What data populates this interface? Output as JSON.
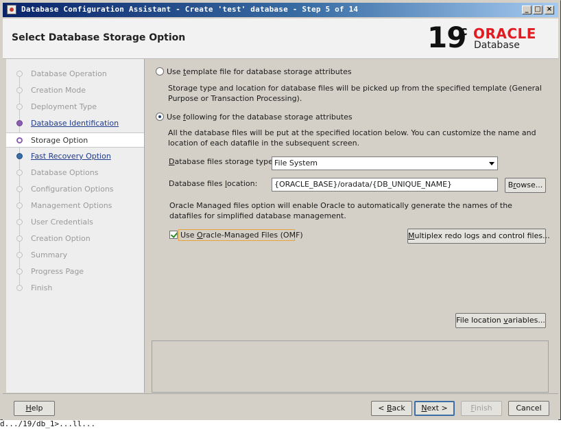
{
  "window": {
    "title": "Database Configuration Assistant - Create 'test' database - Step 5 of 14",
    "controls": {
      "minimize": "_",
      "maximize": "□",
      "close": "×"
    }
  },
  "header": {
    "page_title": "Select Database Storage Option",
    "version_number": "19",
    "version_suffix": "c",
    "brand": "ORACLE",
    "product": "Database",
    "brand_color": "#e11b22"
  },
  "nav": {
    "items": [
      {
        "label": "Database Operation",
        "state": "pending"
      },
      {
        "label": "Creation Mode",
        "state": "pending"
      },
      {
        "label": "Deployment Type",
        "state": "pending"
      },
      {
        "label": "Database Identification",
        "state": "done"
      },
      {
        "label": "Storage Option",
        "state": "current"
      },
      {
        "label": "Fast Recovery Option",
        "state": "next"
      },
      {
        "label": "Database Options",
        "state": "pending"
      },
      {
        "label": "Configuration Options",
        "state": "pending"
      },
      {
        "label": "Management Options",
        "state": "pending"
      },
      {
        "label": "User Credentials",
        "state": "pending"
      },
      {
        "label": "Creation Option",
        "state": "pending"
      },
      {
        "label": "Summary",
        "state": "pending"
      },
      {
        "label": "Progress Page",
        "state": "pending"
      },
      {
        "label": "Finish",
        "state": "pending"
      }
    ]
  },
  "content": {
    "template_option": {
      "label_pre": "Use ",
      "label_mn": "t",
      "label_post": "emplate file for database storage attributes",
      "selected": false,
      "description": "Storage type and location for database files will be picked up from the specified template (General Purpose or Transaction Processing)."
    },
    "following_option": {
      "label_pre": "Use ",
      "label_mn": "f",
      "label_post": "ollowing for the database storage attributes",
      "selected": true,
      "description": "All the database files will be put at the specified location below. You can customize the name and location of each datafile in the subsequent screen."
    },
    "storage_type": {
      "label_mn": "D",
      "label_post": "atabase files storage type:",
      "value": "File System"
    },
    "files_location": {
      "label_pre": "Database files ",
      "label_mn": "l",
      "label_post": "ocation:",
      "value": "{ORACLE_BASE}/oradata/{DB_UNIQUE_NAME}"
    },
    "browse_button": {
      "pre": "B",
      "mn": "r",
      "post": "owse..."
    },
    "omf_description": "Oracle Managed files option will enable Oracle to automatically generate the names of the datafiles for simplified database management.",
    "omf_checkbox": {
      "label_pre": "Use ",
      "label_mn": "O",
      "label_post": "racle-Managed Files (OMF)",
      "checked": true
    },
    "multiplex_button": {
      "pre": "",
      "mn": "M",
      "post": "ultiplex redo logs and control files..."
    },
    "file_location_vars_button": {
      "pre": "File location ",
      "mn": "v",
      "post": "ariables..."
    }
  },
  "footer": {
    "help": {
      "pre": "",
      "mn": "H",
      "post": "elp"
    },
    "back": {
      "pre": "< ",
      "mn": "B",
      "post": "ack"
    },
    "next": {
      "pre": "",
      "mn": "N",
      "post": "ext >"
    },
    "finish": {
      "pre": "",
      "mn": "F",
      "post": "inish"
    },
    "cancel": {
      "pre": "",
      "mn": "",
      "post": "Cancel"
    }
  },
  "terminal_fragment": "d.../19/db_1>...ll..."
}
